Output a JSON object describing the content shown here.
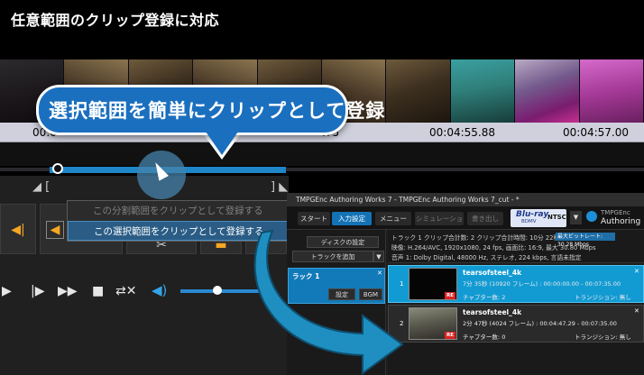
{
  "page_title": "任意範囲のクリップ登録に対応",
  "callout": {
    "text": "選択範囲を簡単にクリップとして登録"
  },
  "timeline": {
    "timecodes": [
      "00:0",
      ".75",
      "00:04:55.88",
      "00:04:57.00"
    ]
  },
  "context_menu": {
    "items": [
      {
        "label": "この分割範囲をクリップとして登録する",
        "enabled": false
      },
      {
        "label": "この選択範囲をクリップとして登録する",
        "enabled": true
      }
    ]
  },
  "authoring": {
    "window_title": "TMPGEnc Authoring Works 7 - TMPGEnc Authoring Works 7_cut - *",
    "tabs": [
      "スタート",
      "入力設定",
      "メニュー",
      "シミュレーション",
      "書き出し"
    ],
    "active_tab": "入力設定",
    "format": {
      "logo": "Blu-ray",
      "sub": "BDMV",
      "standard": "NTSC"
    },
    "brand": {
      "line1": "TMPGEnc",
      "line2": "Authoring"
    },
    "left_panel": {
      "disc_settings": "ディスクの設定",
      "add_track": "トラックを追加",
      "track_label": "ラック 1",
      "settings_button": "設定",
      "bgm_button": "BGM"
    },
    "info": {
      "line1": "トラック 1    クリップ合計数: 2    クリップ合計時間: 10分 22秒",
      "bitrate": "最大ビットレート: 30.28 Mbps",
      "line2": "映像:    H.264/AVC, 1920x1080, 24 fps, 画面比: 16:9, 最大 30.80 Mbps",
      "line3": "音声 1:  Dolby Digital, 48000 Hz, ステレオ, 224 kbps, 言語未指定"
    },
    "clips": [
      {
        "num": "1",
        "name": "tearsofsteel_4k",
        "duration": "7分 35秒 (10920 フレーム) : 00:00:00.00 - 00:07:35.00",
        "chapters": "チャプター数: 2",
        "transition": "トランジション: 無し"
      },
      {
        "num": "2",
        "name": "tearsofsteel_4k",
        "duration": "2分 47秒 (4024 フレーム) : 00:04:47.29 - 00:07:35.00",
        "chapters": "チャプター数: 0",
        "transition": "トランジション: 無し"
      }
    ],
    "re_badge": "RE"
  },
  "colors": {
    "accent_blue": "#1b6fbf",
    "selection_blue": "#1f86c8",
    "clip_selected": "#129bd3",
    "arrow_blue": "#1e8fc0"
  }
}
